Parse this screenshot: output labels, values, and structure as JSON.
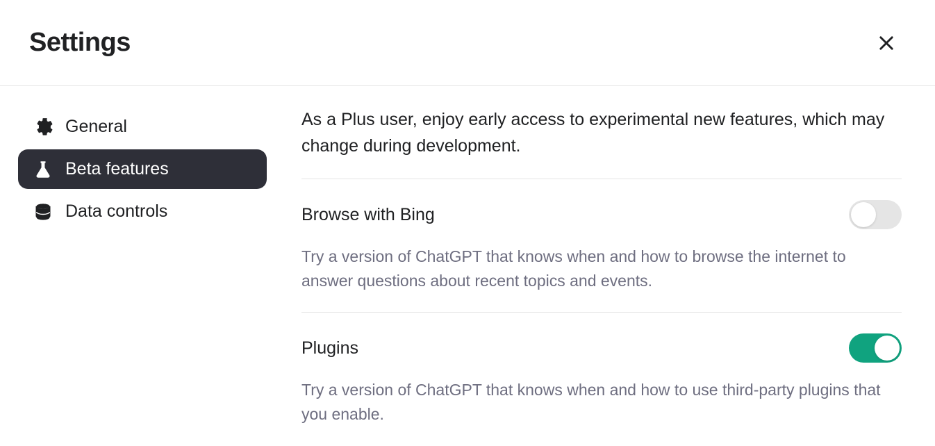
{
  "header": {
    "title": "Settings"
  },
  "sidebar": {
    "items": [
      {
        "label": "General",
        "active": false
      },
      {
        "label": "Beta features",
        "active": true
      },
      {
        "label": "Data controls",
        "active": false
      }
    ]
  },
  "content": {
    "intro": "As a Plus user, enjoy early access to experimental new features, which may change during development.",
    "sections": [
      {
        "title": "Browse with Bing",
        "description": "Try a version of ChatGPT that knows when and how to browse the internet to answer questions about recent topics and events.",
        "enabled": false
      },
      {
        "title": "Plugins",
        "description": "Try a version of ChatGPT that knows when and how to use third-party plugins that you enable.",
        "enabled": true
      }
    ]
  }
}
